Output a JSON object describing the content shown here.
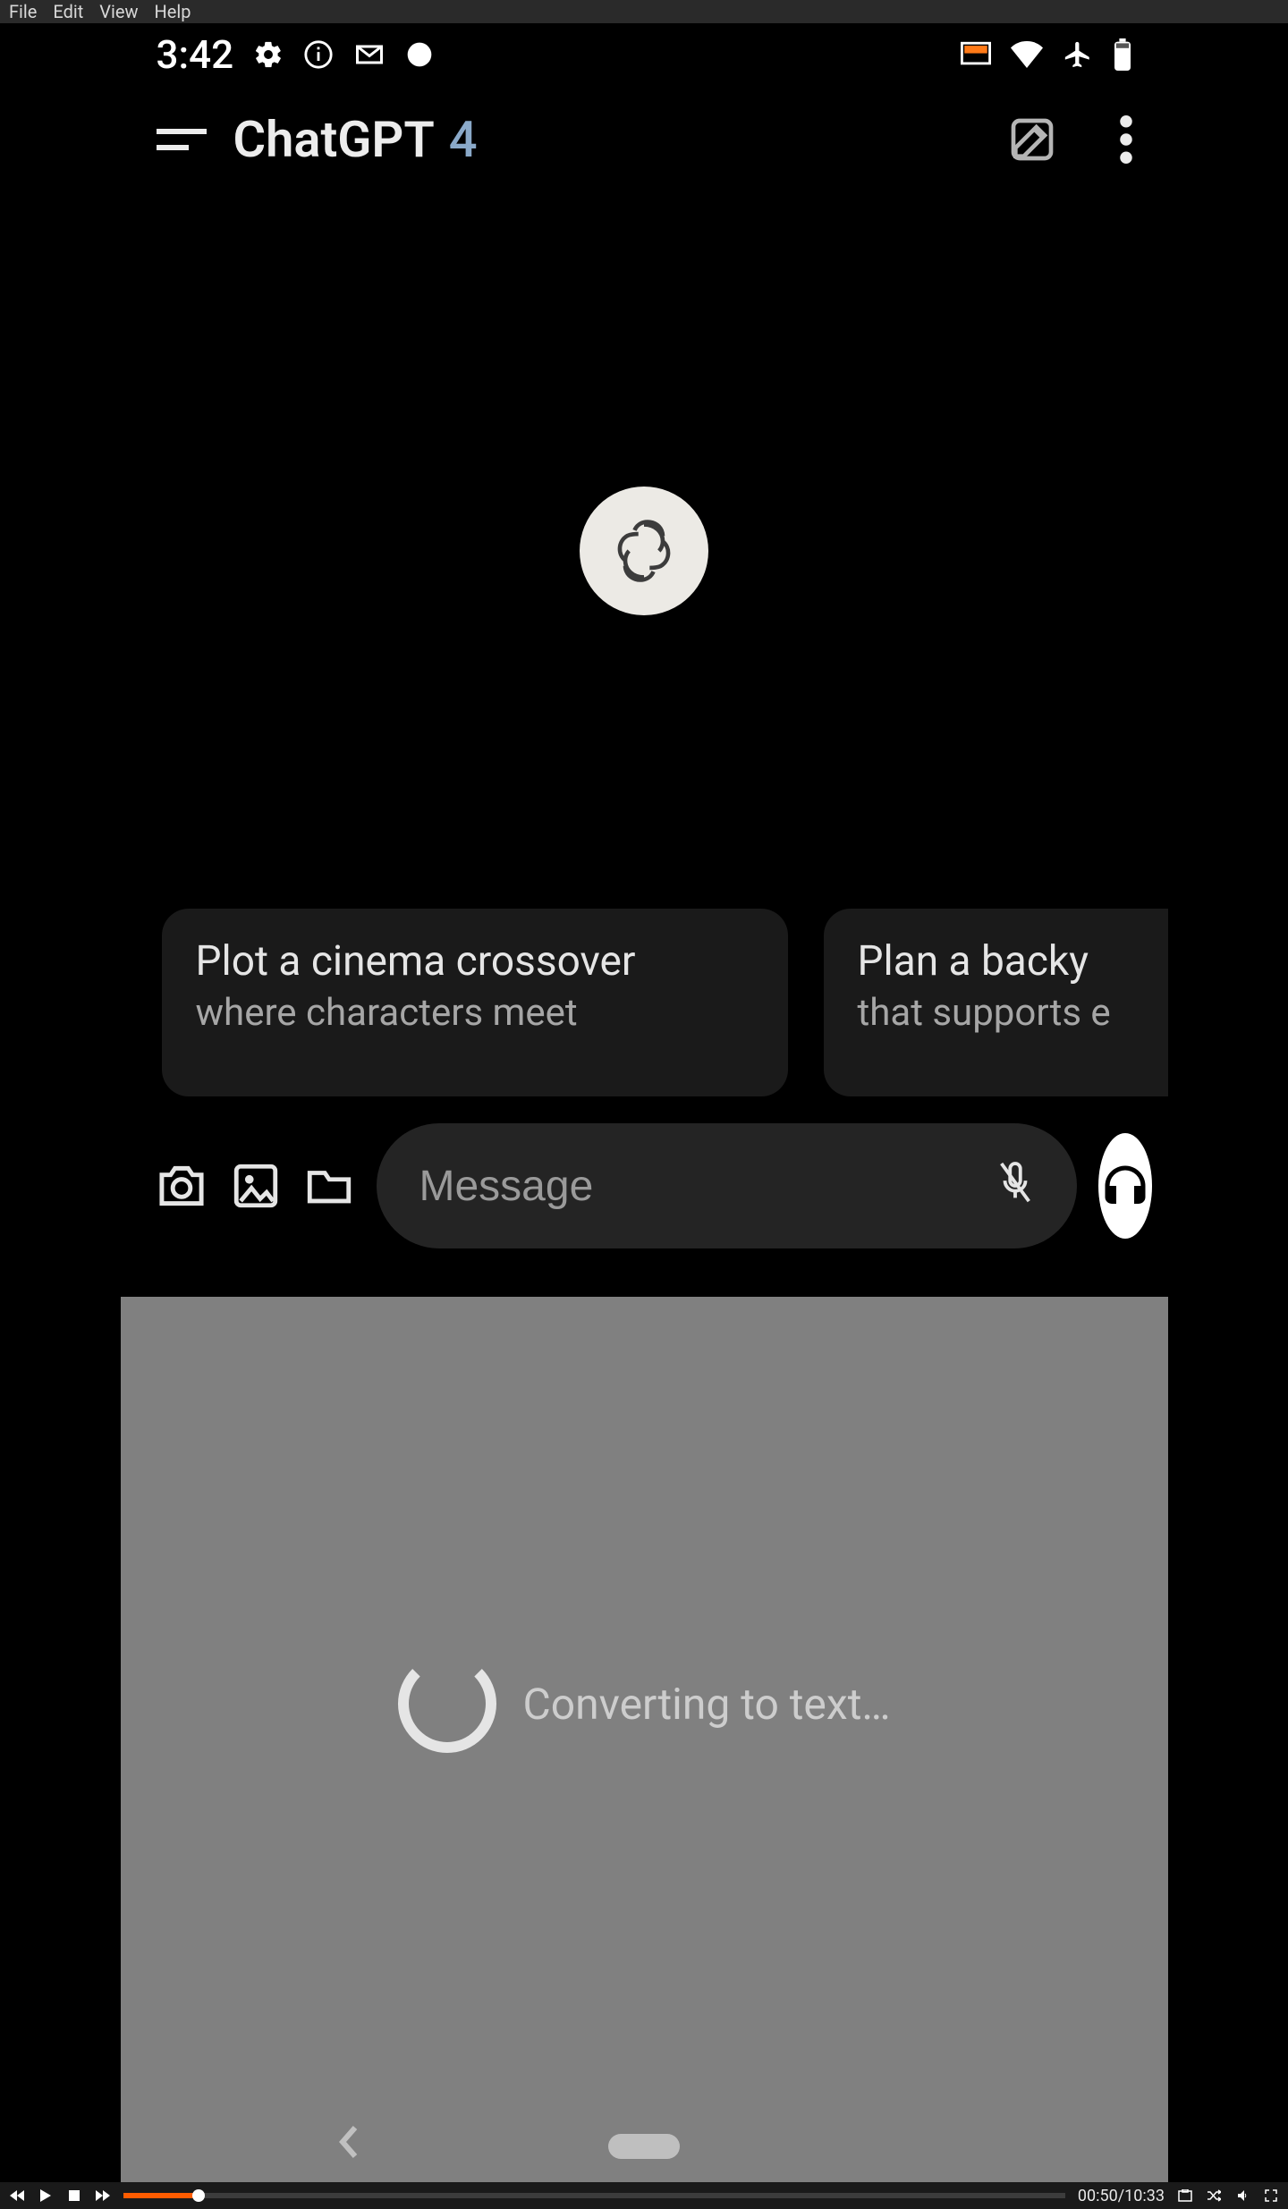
{
  "menubar": {
    "items": [
      "File",
      "Edit",
      "View",
      "Help"
    ]
  },
  "status": {
    "time": "3:42"
  },
  "header": {
    "title": "ChatGPT",
    "version": "4"
  },
  "suggestions": [
    {
      "title": "Plot a cinema crossover",
      "sub": "where characters meet"
    },
    {
      "title": "Plan a backy",
      "sub": "that supports e"
    }
  ],
  "input": {
    "placeholder": "Message"
  },
  "convert": {
    "text": "Converting to text…"
  },
  "player": {
    "current": "00:50",
    "total": "10:33",
    "progress_pct": 8
  }
}
